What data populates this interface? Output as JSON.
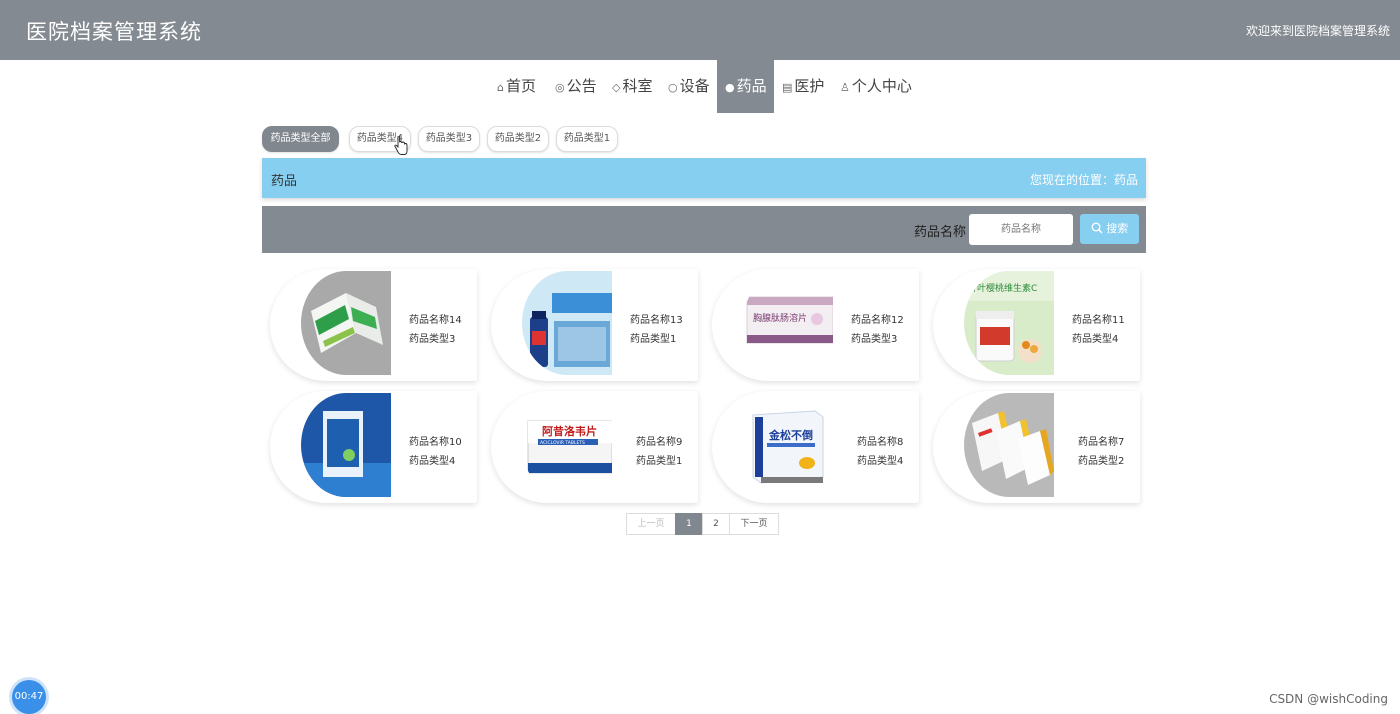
{
  "header": {
    "title": "医院档案管理系统",
    "welcome": "欢迎来到医院档案管理系统"
  },
  "nav": [
    {
      "icon": "home-icon",
      "glyph": "⌂",
      "label": "首页",
      "active": false
    },
    {
      "icon": "announcement-icon",
      "glyph": "◎",
      "label": "公告",
      "active": false
    },
    {
      "icon": "tag-icon",
      "glyph": "◇",
      "label": "科室",
      "active": false
    },
    {
      "icon": "device-icon",
      "glyph": "○",
      "label": "设备",
      "active": false
    },
    {
      "icon": "medicine-icon",
      "glyph": "●",
      "label": "药品",
      "active": true
    },
    {
      "icon": "clipboard-icon",
      "glyph": "▤",
      "label": "医护",
      "active": false
    },
    {
      "icon": "user-icon",
      "glyph": "♙",
      "label": "个人中心",
      "active": false
    }
  ],
  "types": [
    {
      "label": "药品类型全部",
      "active": true
    },
    {
      "label": "药品类型4",
      "active": false
    },
    {
      "label": "药品类型3",
      "active": false
    },
    {
      "label": "药品类型2",
      "active": false
    },
    {
      "label": "药品类型1",
      "active": false
    }
  ],
  "breadcrumb": {
    "title": "药品",
    "position": "您现在的位置：药品"
  },
  "search": {
    "label": "药品名称",
    "placeholder": "药品名称",
    "button": "搜索"
  },
  "products": [
    {
      "name": "药品名称14",
      "type": "药品类型3",
      "image": "green-medicine-box"
    },
    {
      "name": "药品名称13",
      "type": "药品类型1",
      "image": "blue-bottle-ad"
    },
    {
      "name": "药品名称12",
      "type": "药品类型3",
      "image": "capsule-box"
    },
    {
      "name": "药品名称11",
      "type": "药品类型4",
      "image": "vitamin-jar"
    },
    {
      "name": "药品名称10",
      "type": "药品类型4",
      "image": "blue-medicine-box"
    },
    {
      "name": "药品名称9",
      "type": "药品类型1",
      "image": "tablet-box"
    },
    {
      "name": "药品名称8",
      "type": "药品类型4",
      "image": "blue-yellow-box"
    },
    {
      "name": "药品名称7",
      "type": "药品类型2",
      "image": "yellow-boxes"
    }
  ],
  "box_texts": {
    "aciclovir_cn": "阿昔洛韦片",
    "aciclovir_en": "ACICLOVIR TABLETS",
    "vitamin": "针叶樱桃维生素C",
    "capsule": "胸腺肽肠溶片",
    "blue_yellow": "金松不倒"
  },
  "pager": {
    "prev": "上一页",
    "pages": [
      "1",
      "2"
    ],
    "current": "1",
    "next": "下一页"
  },
  "timer": "00:47",
  "watermark": "CSDN @wishCoding",
  "colors": {
    "header": "#838a91",
    "accent": "#87cff1",
    "active": "#80878e"
  }
}
